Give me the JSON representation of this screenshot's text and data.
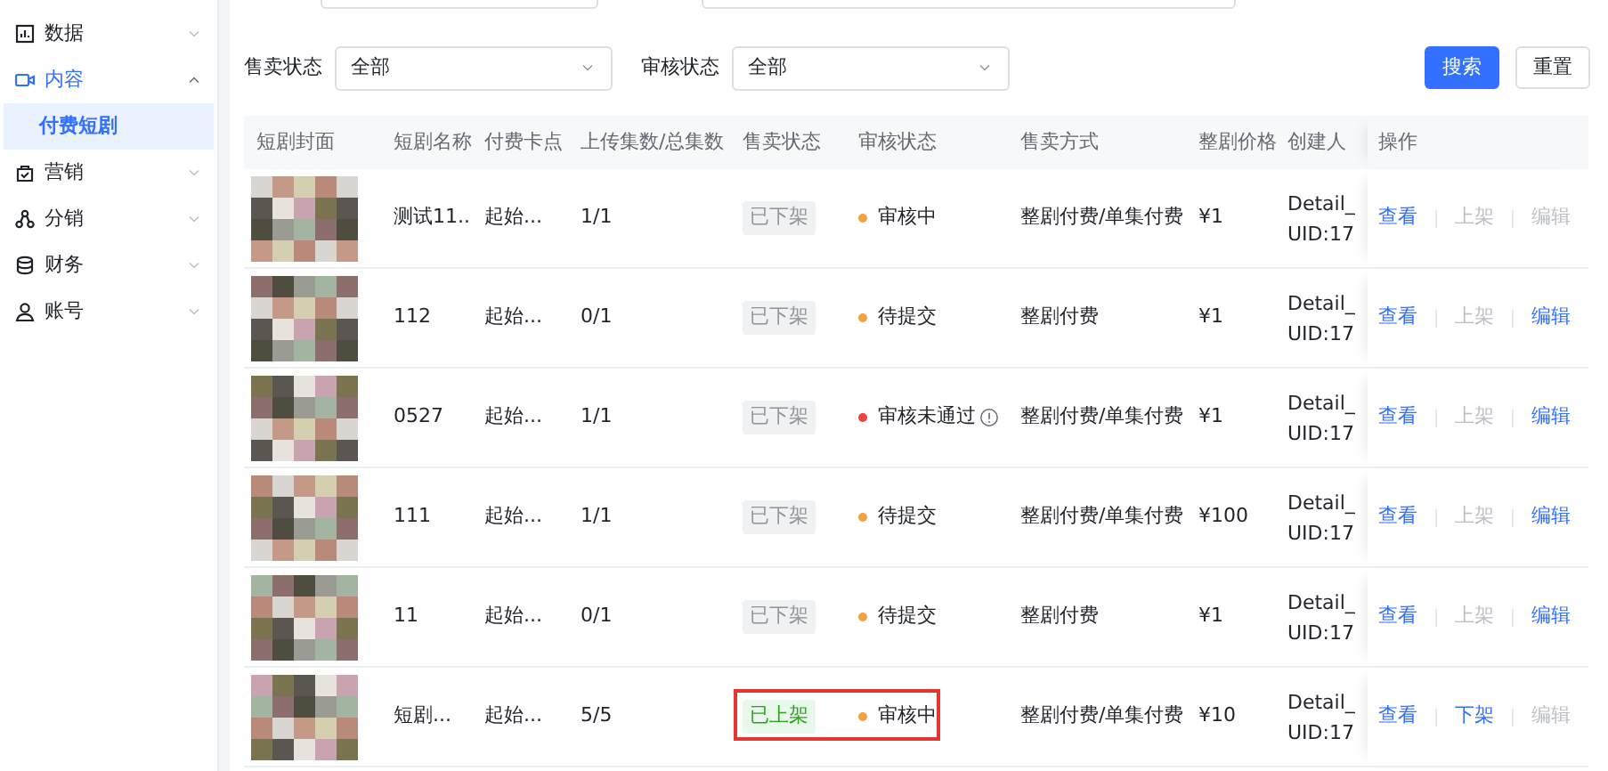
{
  "sidebar": {
    "items": [
      {
        "label": "数据",
        "expanded": false
      },
      {
        "label": "内容",
        "expanded": true,
        "children": [
          {
            "label": "付费短剧",
            "selected": true
          }
        ]
      },
      {
        "label": "营销",
        "expanded": false
      },
      {
        "label": "分销",
        "expanded": false
      },
      {
        "label": "财务",
        "expanded": false
      },
      {
        "label": "账号",
        "expanded": false
      }
    ]
  },
  "top_fields": [
    {
      "kind": "input"
    },
    {
      "kind": "input"
    }
  ],
  "filters": [
    {
      "label": "售卖状态",
      "value": "全部"
    },
    {
      "label": "审核状态",
      "value": "全部"
    }
  ],
  "buttons": [
    {
      "label": "搜索",
      "kind": "primary"
    },
    {
      "label": "重置",
      "kind": "default"
    }
  ],
  "table": {
    "columns": [
      "短剧封面",
      "短剧名称",
      "付费卡点",
      "上传集数/总集数",
      "售卖状态",
      "审核状态",
      "售卖方式",
      "整剧价格",
      "创建人",
      "操作"
    ],
    "rows": [
      {
        "name": "测试11...",
        "pay_point": "起始...",
        "episodes": "1/1",
        "sale": {
          "text": "已下架",
          "listed": false
        },
        "review": {
          "text": "审核中",
          "color": "#f5a03a",
          "info": false
        },
        "method": "整剧付费/单集付费",
        "price": "¥1",
        "creator": [
          "Detail_",
          "UID:17"
        ],
        "actions": [
          {
            "label": "查看",
            "disabled": false
          },
          {
            "label": "上架",
            "disabled": true
          },
          {
            "label": "编辑",
            "disabled": true
          }
        ],
        "highlighted": false
      },
      {
        "name": "112",
        "pay_point": "起始...",
        "episodes": "0/1",
        "sale": {
          "text": "已下架",
          "listed": false
        },
        "review": {
          "text": "待提交",
          "color": "#f5a03a",
          "info": false
        },
        "method": "整剧付费",
        "price": "¥1",
        "creator": [
          "Detail_",
          "UID:17"
        ],
        "actions": [
          {
            "label": "查看",
            "disabled": false
          },
          {
            "label": "上架",
            "disabled": true
          },
          {
            "label": "编辑",
            "disabled": false
          }
        ],
        "highlighted": false
      },
      {
        "name": "0527",
        "pay_point": "起始...",
        "episodes": "1/1",
        "sale": {
          "text": "已下架",
          "listed": false
        },
        "review": {
          "text": "审核未通过",
          "color": "#f04142",
          "info": true
        },
        "method": "整剧付费/单集付费",
        "price": "¥1",
        "creator": [
          "Detail_",
          "UID:17"
        ],
        "actions": [
          {
            "label": "查看",
            "disabled": false
          },
          {
            "label": "上架",
            "disabled": true
          },
          {
            "label": "编辑",
            "disabled": false
          }
        ],
        "highlighted": false
      },
      {
        "name": "111",
        "pay_point": "起始...",
        "episodes": "1/1",
        "sale": {
          "text": "已下架",
          "listed": false
        },
        "review": {
          "text": "待提交",
          "color": "#f5a03a",
          "info": false
        },
        "method": "整剧付费/单集付费",
        "price": "¥100",
        "creator": [
          "Detail_",
          "UID:17"
        ],
        "actions": [
          {
            "label": "查看",
            "disabled": false
          },
          {
            "label": "上架",
            "disabled": true
          },
          {
            "label": "编辑",
            "disabled": false
          }
        ],
        "highlighted": false
      },
      {
        "name": "11",
        "pay_point": "起始...",
        "episodes": "0/1",
        "sale": {
          "text": "已下架",
          "listed": false
        },
        "review": {
          "text": "待提交",
          "color": "#f5a03a",
          "info": false
        },
        "method": "整剧付费",
        "price": "¥1",
        "creator": [
          "Detail_",
          "UID:17"
        ],
        "actions": [
          {
            "label": "查看",
            "disabled": false
          },
          {
            "label": "上架",
            "disabled": true
          },
          {
            "label": "编辑",
            "disabled": false
          }
        ],
        "highlighted": false
      },
      {
        "name": "短剧...",
        "pay_point": "起始...",
        "episodes": "5/5",
        "sale": {
          "text": "已上架",
          "listed": true
        },
        "review": {
          "text": "审核中",
          "color": "#f5a03a",
          "info": false
        },
        "method": "整剧付费/单集付费",
        "price": "¥10",
        "creator": [
          "Detail_",
          "UID:17"
        ],
        "actions": [
          {
            "label": "查看",
            "disabled": false
          },
          {
            "label": "下架",
            "disabled": false
          },
          {
            "label": "编辑",
            "disabled": true
          }
        ],
        "highlighted": true
      }
    ]
  }
}
